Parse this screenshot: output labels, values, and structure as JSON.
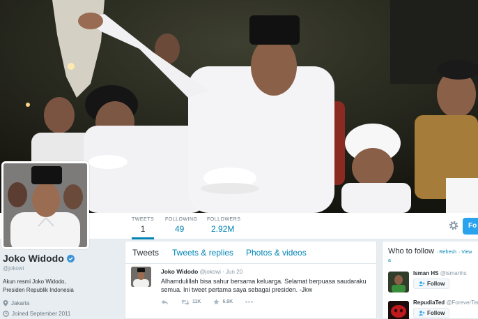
{
  "stats": {
    "tweets_label": "TWEETS",
    "tweets_value": "1",
    "following_label": "FOLLOWING",
    "following_value": "49",
    "followers_label": "FOLLOWERS",
    "followers_value": "2.92M",
    "follow_label": "Fo"
  },
  "profile": {
    "name": "Joko Widodo",
    "handle": "@jokowi",
    "bio": "Akun resmi Joko Widodo, Presiden Republik Indonesia",
    "location": "Jakarta",
    "joined": "Joined September 2011"
  },
  "timeline": {
    "tabs": [
      "Tweets",
      "Tweets & replies",
      "Photos & videos"
    ],
    "tweet": {
      "name": "Joko Widodo",
      "handle": "@jokowi",
      "date": "· Jun 20",
      "text": "Alhamdulillah bisa sahur bersama keluarga. Selamat berpuasa saudaraku semua. Ini tweet pertama saya sebagai presiden. -Jkw",
      "retweets": "11K",
      "favorites": "6.9K"
    }
  },
  "who_to_follow": {
    "title": "Who to follow",
    "refresh": "· Refresh",
    "view_all": "· View a",
    "items": [
      {
        "name": "Isman HS",
        "handle": "@ismanhs",
        "button": "Follow"
      },
      {
        "name": "RepudiaTed",
        "handle": "@ForeverTed",
        "button": "Follow"
      }
    ]
  },
  "colors": {
    "link": "#0084b4",
    "button": "#2aa3ef",
    "verified": "#3b94d9"
  }
}
